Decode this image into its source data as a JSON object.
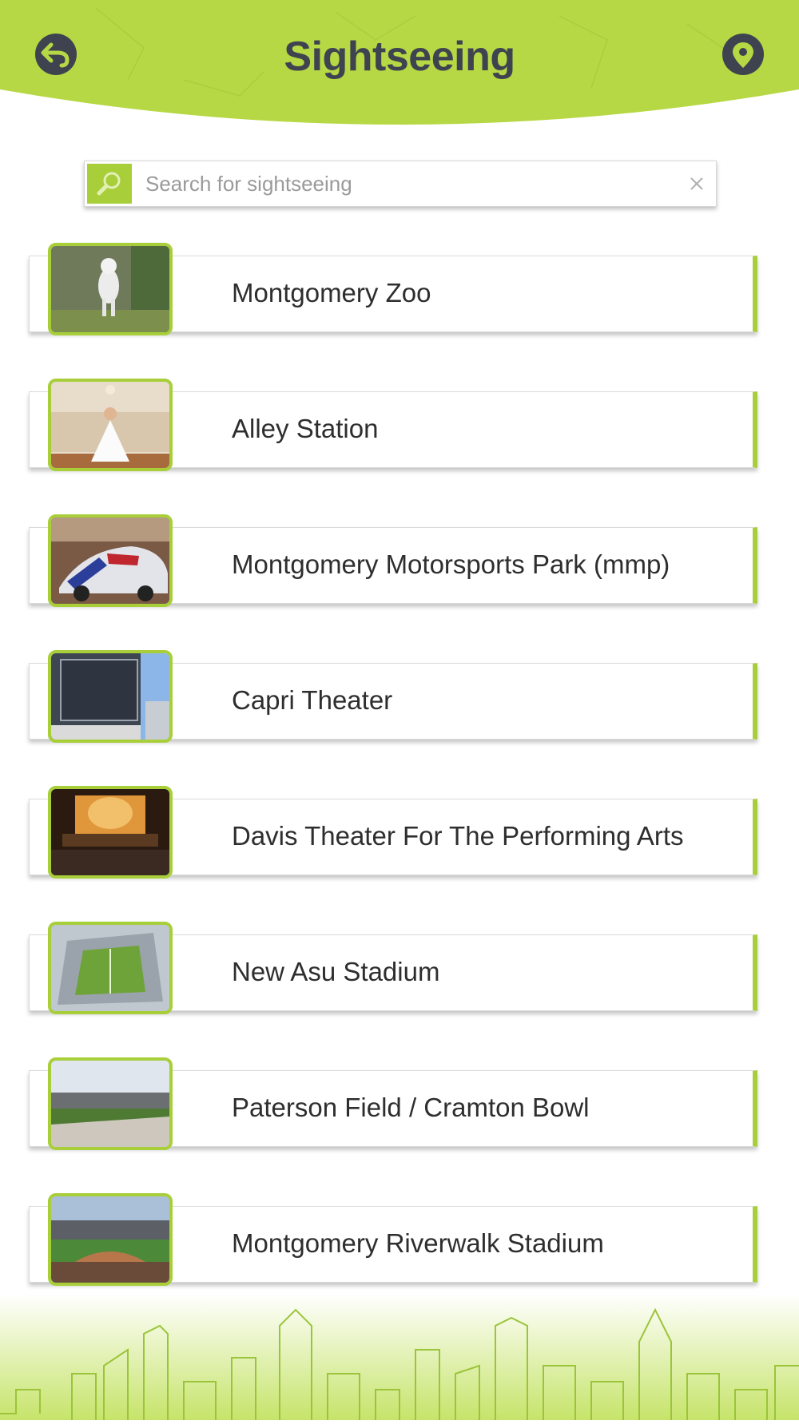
{
  "header": {
    "title": "Sightseeing",
    "back_icon": "back-arrow-icon",
    "location_icon": "location-pin-icon"
  },
  "search": {
    "placeholder": "Search for sightseeing",
    "value": "",
    "icon": "magnifier-icon",
    "clear_icon": "close-icon"
  },
  "items": [
    {
      "label": "Montgomery Zoo",
      "image": "white tiger"
    },
    {
      "label": "Alley Station",
      "image": "bride on tufted sofa"
    },
    {
      "label": "Montgomery Motorsports Park (mmp)",
      "image": "flag-painted dragster"
    },
    {
      "label": "Capri Theater",
      "image": "Capri Theatre sign"
    },
    {
      "label": "Davis Theater For The Performing Arts",
      "image": "orchestra on stage"
    },
    {
      "label": "New Asu Stadium",
      "image": "aerial football stadium"
    },
    {
      "label": "Paterson Field / Cramton Bowl",
      "image": "stadium field and stands"
    },
    {
      "label": "Montgomery Riverwalk Stadium",
      "image": "baseball stadium at dusk"
    }
  ],
  "colors": {
    "accent": "#a8cf3a",
    "header_bg": "#b6d844",
    "title": "#3f4350",
    "text": "#2e2e2e"
  }
}
